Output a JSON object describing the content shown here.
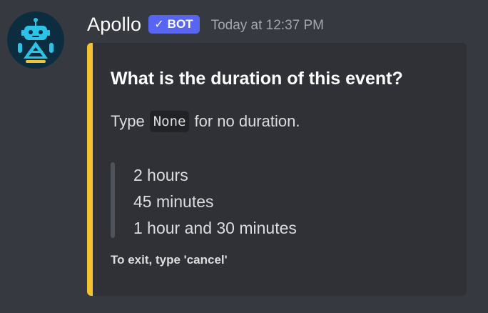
{
  "message": {
    "username": "Apollo",
    "bot_tag": {
      "check": "✓",
      "label": "BOT"
    },
    "timestamp": "Today at 12:37 PM",
    "avatar_icon": "robot-avatar-icon"
  },
  "embed": {
    "accent_color": "#f2c230",
    "title": "What is the duration of this event?",
    "description": {
      "before": "Type",
      "code": "None",
      "after": "for no duration."
    },
    "examples": [
      "2 hours",
      "45 minutes",
      "1 hour and 30 minutes"
    ],
    "footer": "To exit, type 'cancel'"
  },
  "colors": {
    "background": "#36393f",
    "embed_background": "#2f3136",
    "bot_tag": "#5865f2"
  }
}
